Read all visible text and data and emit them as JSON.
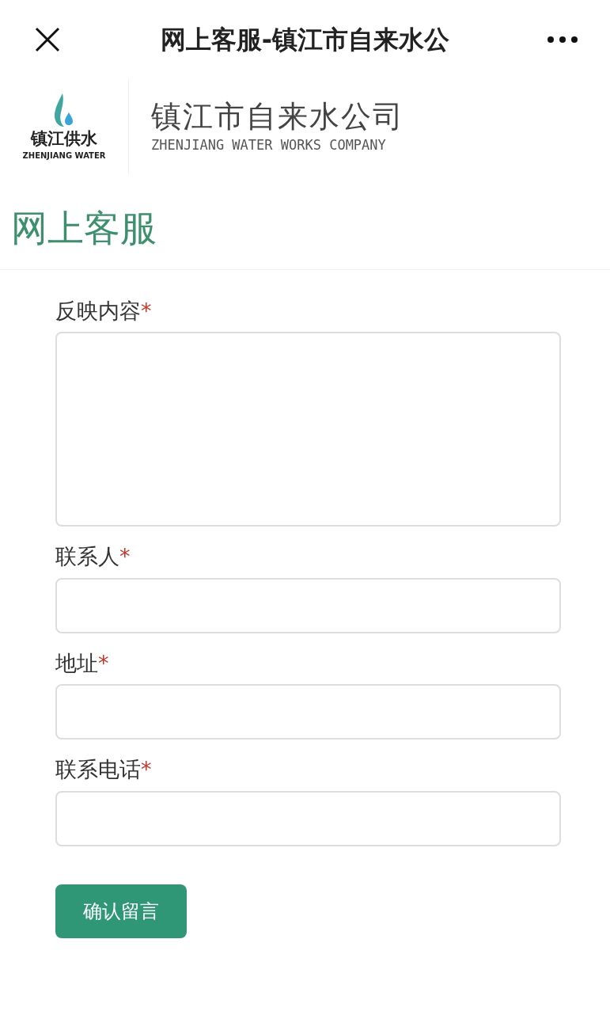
{
  "top_bar": {
    "title": "网上客服-镇江市自来水公"
  },
  "brand": {
    "logo_text": "镇江供水",
    "logo_subtext": "ZHENJIANG WATER",
    "name": "镇江市自来水公司",
    "name_en": "ZHENJIANG WATER WORKS COMPANY"
  },
  "heading": "网上客服",
  "form": {
    "fields": [
      {
        "label": "反映内容",
        "required_mark": "*",
        "kind": "textarea"
      },
      {
        "label": "联系人",
        "required_mark": "*",
        "kind": "input"
      },
      {
        "label": "地址",
        "required_mark": "*",
        "kind": "input"
      },
      {
        "label": "联系电话",
        "required_mark": "*",
        "kind": "input"
      }
    ],
    "submit": "确认留言"
  }
}
